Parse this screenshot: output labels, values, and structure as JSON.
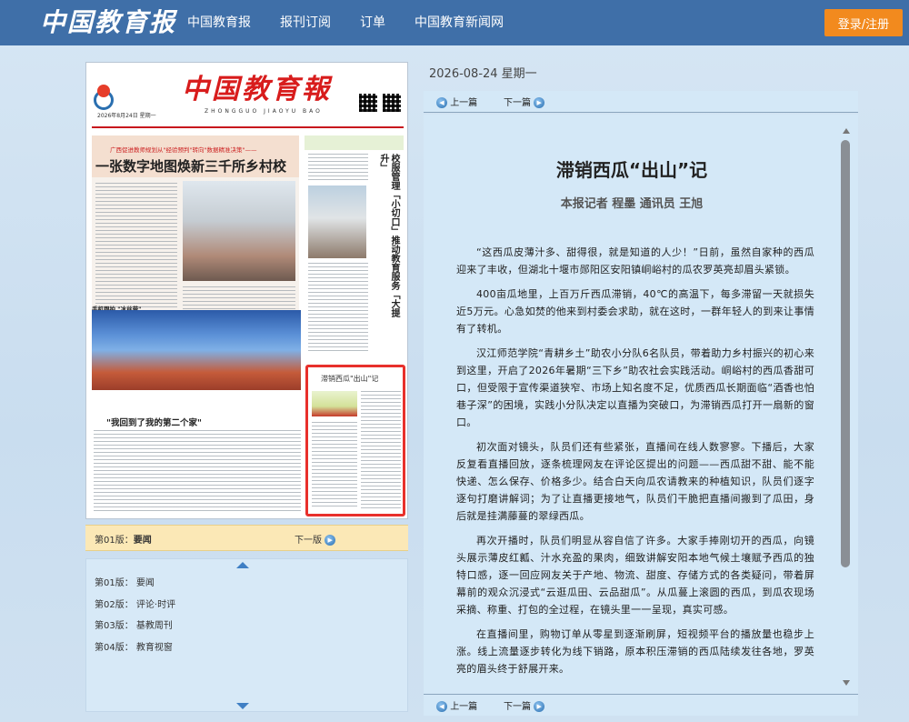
{
  "header": {
    "logo": "中国教育报",
    "nav": [
      "中国教育报",
      "报刊订阅",
      "订单",
      "中国教育新闻网"
    ],
    "login": "登录/注册"
  },
  "paper": {
    "masthead": "中国教育報",
    "subtitle": "ZHONGGUO JIAOYU BAO",
    "date_line": "2026年8月24日 星期一",
    "lead_kicker": "广西促进教师规划从\"经验预判\"转向\"数据精准决策\"——",
    "lead_title": "一张数字地图焕新三千所乡村校",
    "side_title": "校服管理「小切口」推动教育服务「大提升」",
    "sport_caption": "手机跟拍 \"冰丝带\"",
    "foot_title": "\"我回到了我的第二个家\"",
    "highlight_title": "滞销西瓜\"出山\"记"
  },
  "pagebar": {
    "current_label": "第01版：",
    "current_name": "要闻",
    "next": "下一版"
  },
  "pagelist": [
    {
      "num": "第01版：",
      "name": "要闻"
    },
    {
      "num": "第02版：",
      "name": "评论·时评"
    },
    {
      "num": "第03版：",
      "name": "基教周刊"
    },
    {
      "num": "第04版：",
      "name": "教育视窗"
    }
  ],
  "article": {
    "date": "2026-08-24  星期一",
    "prev": "上一篇",
    "next": "下一篇",
    "title": "滞销西瓜“出山”记",
    "author": "本报记者  程墨  通讯员  王旭",
    "paragraphs": [
      "“这西瓜皮薄汁多、甜得很，就是知道的人少！”日前，虽然自家种的西瓜迎来了丰收，但湖北十堰市郧阳区安阳镇峒峪村的瓜农罗英亮却眉头紧锁。",
      "400亩瓜地里，上百万斤西瓜滞销，40℃的高温下，每多滞留一天就损失近5万元。心急如焚的他来到村委会求助，就在这时，一群年轻人的到来让事情有了转机。",
      "汉江师范学院“青耕乡土”助农小分队6名队员，带着助力乡村振兴的初心来到这里，开启了2026年暑期“三下乡”助农社会实践活动。峒峪村的西瓜香甜可口，但受限于宣传渠道狭窄、市场上知名度不足，优质西瓜长期面临“酒香也怕巷子深”的困境，实践小分队决定以直播为突破口，为滞销西瓜打开一扇新的窗口。",
      "初次面对镜头，队员们还有些紧张，直播间在线人数寥寥。下播后，大家反复看直播回放，逐条梳理网友在评论区提出的问题——西瓜甜不甜、能不能快递、怎么保存、价格多少。结合白天向瓜农请教来的种植知识，队员们逐字逐句打磨讲解词；为了让直播更接地气，队员们干脆把直播间搬到了瓜田，身后就是挂满藤蔓的翠绿西瓜。",
      "再次开播时，队员们明显从容自信了许多。大家手捧刚切开的西瓜，向镜头展示薄皮红瓤、汁水充盈的果肉，细致讲解安阳本地气候土壤赋予西瓜的独特口感，逐一回应网友关于产地、物流、甜度、存储方式的各类疑问，带着屏幕前的观众沉浸式“云逛瓜田、云品甜瓜”。从瓜蔓上滚圆的西瓜，到瓜农现场采摘、称重、打包的全过程，在镜头里一一呈现，真实可感。",
      "在直播间里，购物订单从零星到逐渐刷屏，短视频平台的播放量也稳步上涨。线上流量逐步转化为线下销路，原本积压滞销的西瓜陆续发往各地，罗英亮的眉头终于舒展开来。"
    ]
  }
}
